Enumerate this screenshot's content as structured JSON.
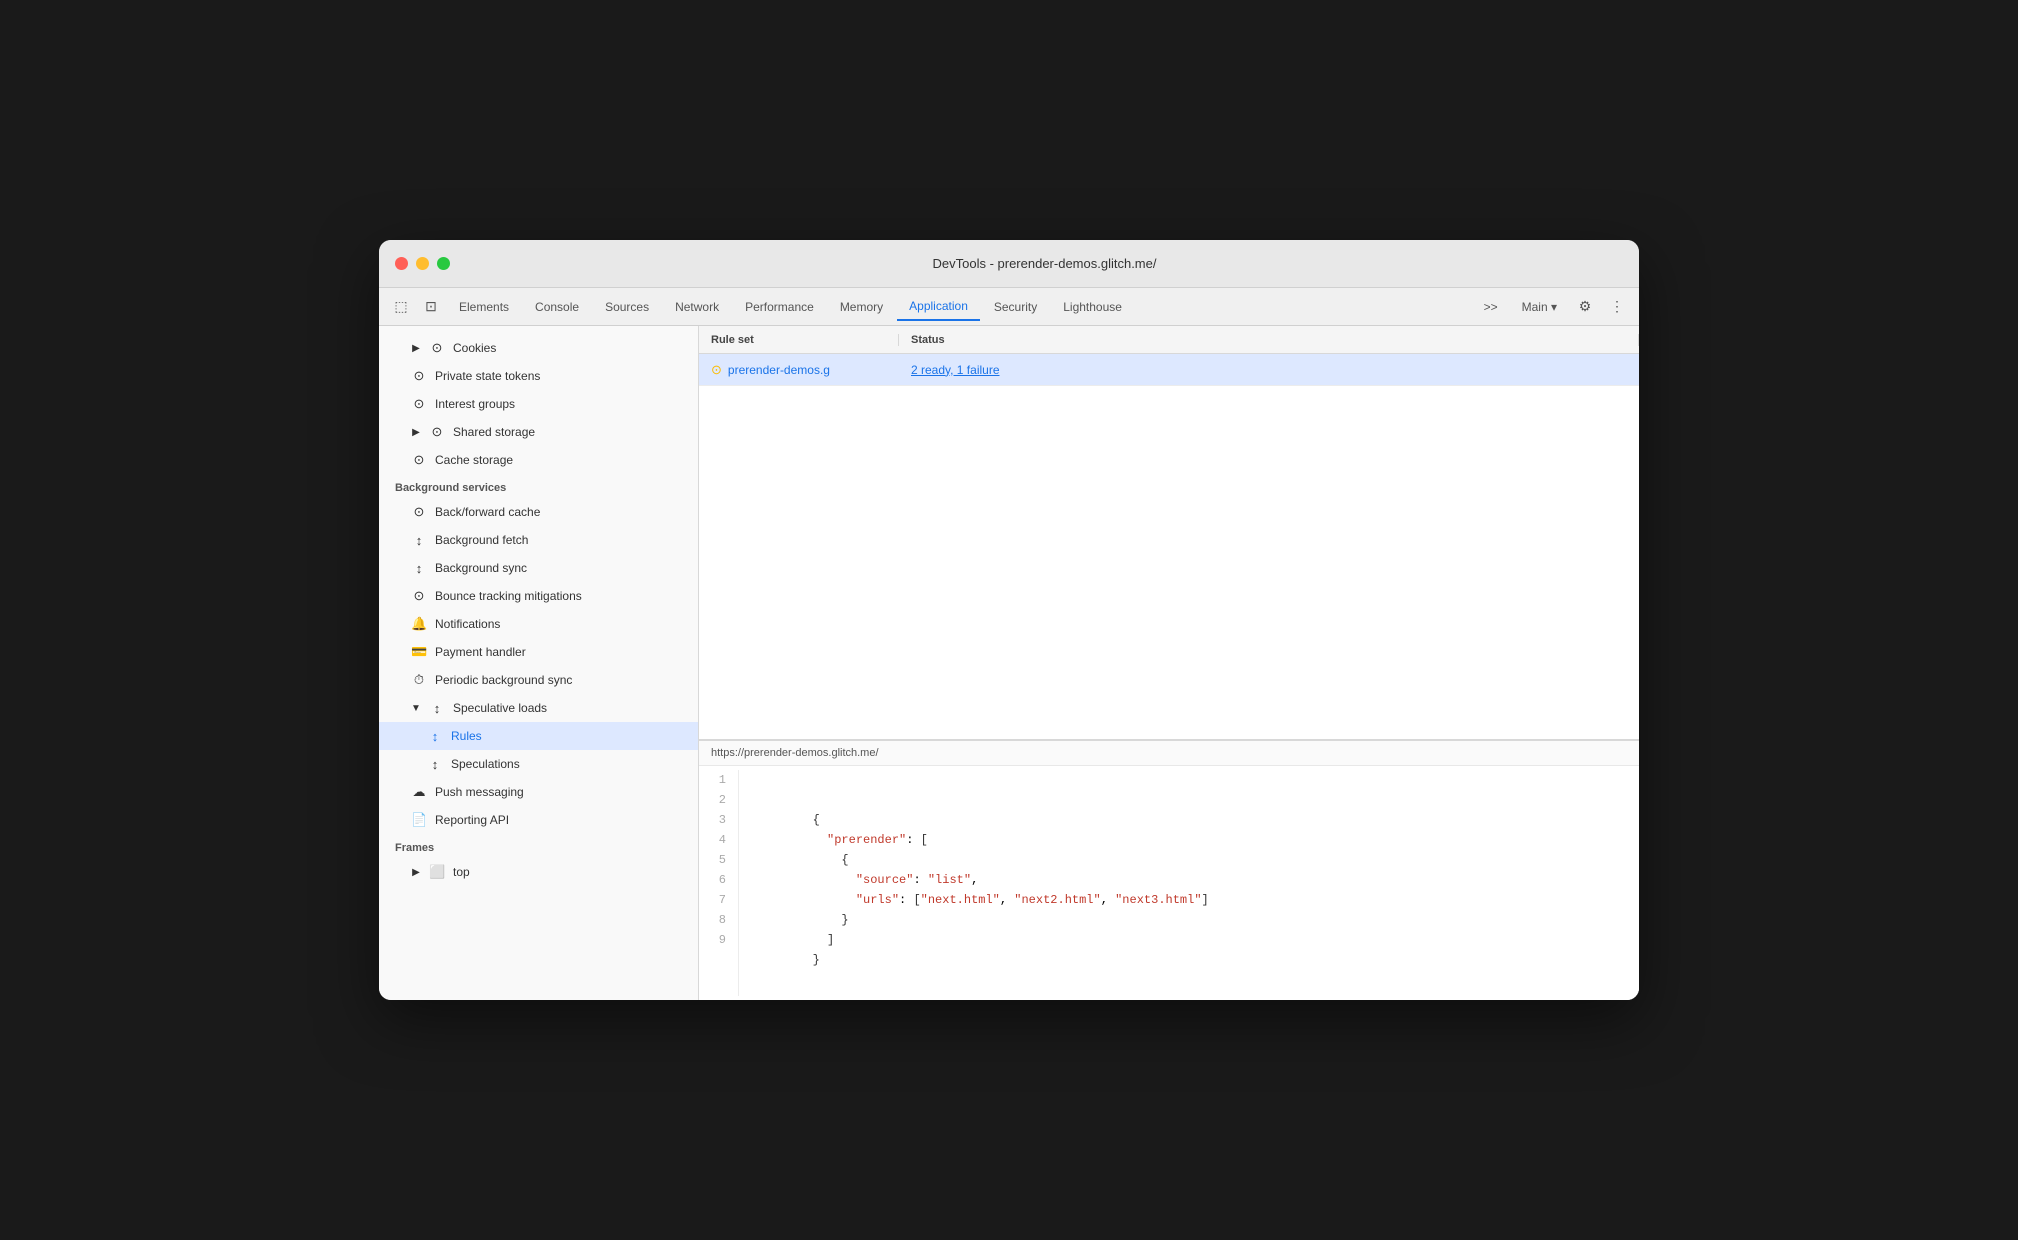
{
  "window": {
    "title": "DevTools - prerender-demos.glitch.me/"
  },
  "tabs": {
    "items": [
      {
        "label": "Elements",
        "active": false
      },
      {
        "label": "Console",
        "active": false
      },
      {
        "label": "Sources",
        "active": false
      },
      {
        "label": "Network",
        "active": false
      },
      {
        "label": "Performance",
        "active": false
      },
      {
        "label": "Memory",
        "active": false
      },
      {
        "label": "Application",
        "active": true
      },
      {
        "label": "Security",
        "active": false
      },
      {
        "label": "Lighthouse",
        "active": false
      }
    ],
    "right": {
      "more": ">>",
      "main": "Main",
      "settings_label": "⚙",
      "more_menu": "⋮"
    }
  },
  "sidebar": {
    "sections": [
      {
        "items": [
          {
            "label": "Cookies",
            "icon": "▶",
            "icon2": "🗄",
            "indent": 1,
            "has_arrow": true
          },
          {
            "label": "Private state tokens",
            "icon": "🗄",
            "indent": 1
          },
          {
            "label": "Interest groups",
            "icon": "🗄",
            "indent": 1
          },
          {
            "label": "Shared storage",
            "icon": "▶",
            "icon2": "🗄",
            "indent": 1,
            "has_arrow": true
          },
          {
            "label": "Cache storage",
            "icon": "🗄",
            "indent": 1
          }
        ]
      },
      {
        "label": "Background services",
        "items": [
          {
            "label": "Back/forward cache",
            "icon": "🗄",
            "indent": 1
          },
          {
            "label": "Background fetch",
            "icon": "↕",
            "indent": 1
          },
          {
            "label": "Background sync",
            "icon": "↕",
            "indent": 1
          },
          {
            "label": "Bounce tracking mitigations",
            "icon": "🗄",
            "indent": 1
          },
          {
            "label": "Notifications",
            "icon": "🔔",
            "indent": 1
          },
          {
            "label": "Payment handler",
            "icon": "💳",
            "indent": 1
          },
          {
            "label": "Periodic background sync",
            "icon": "⏱",
            "indent": 1
          },
          {
            "label": "Speculative loads",
            "icon": "↕",
            "indent": 1,
            "has_arrow": true,
            "expanded": true
          },
          {
            "label": "Rules",
            "icon": "↕",
            "indent": 2,
            "active": true
          },
          {
            "label": "Speculations",
            "icon": "↕",
            "indent": 2
          },
          {
            "label": "Push messaging",
            "icon": "☁",
            "indent": 1
          },
          {
            "label": "Reporting API",
            "icon": "📄",
            "indent": 1
          }
        ]
      },
      {
        "label": "Frames",
        "items": [
          {
            "label": "top",
            "icon": "▶",
            "icon2": "⬜",
            "indent": 1,
            "has_arrow": true
          }
        ]
      }
    ]
  },
  "table": {
    "headers": [
      "Rule set",
      "Status"
    ],
    "row": {
      "rule_set": "prerender-demos.g",
      "status": "2 ready, 1 failure"
    }
  },
  "code": {
    "url": "https://prerender-demos.glitch.me/",
    "lines": [
      {
        "num": 1,
        "content": ""
      },
      {
        "num": 2,
        "content": "        {"
      },
      {
        "num": 3,
        "content": "          \"prerender\": ["
      },
      {
        "num": 4,
        "content": "            {"
      },
      {
        "num": 5,
        "content": "              \"source\": \"list\","
      },
      {
        "num": 6,
        "content": "              \"urls\": [\"next.html\", \"next2.html\", \"next3.html\"]"
      },
      {
        "num": 7,
        "content": "            }"
      },
      {
        "num": 8,
        "content": "          ]"
      },
      {
        "num": 9,
        "content": "        }"
      }
    ]
  }
}
